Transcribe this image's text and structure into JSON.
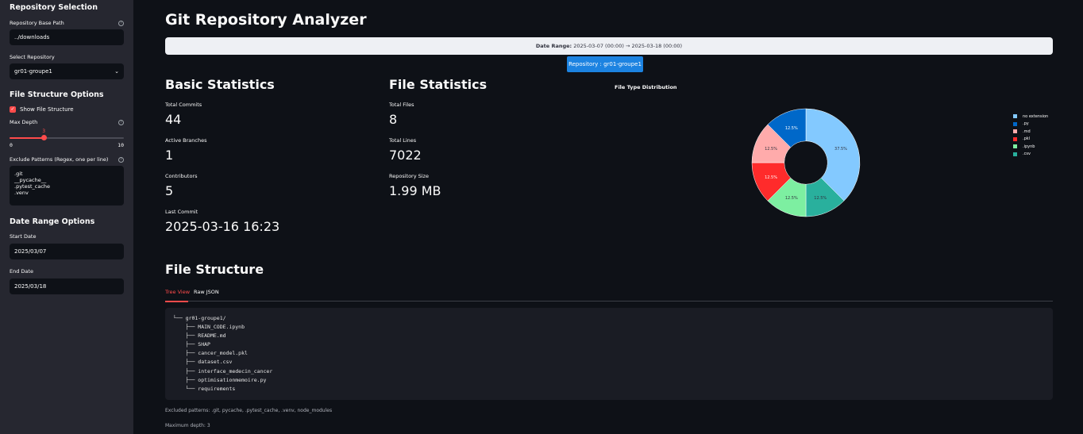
{
  "sidebar": {
    "repo_section": "Repository Selection",
    "base_path_label": "Repository Base Path",
    "base_path_value": "../downloads",
    "select_repo_label": "Select Repository",
    "select_repo_value": "gr01-groupe1",
    "file_struct_section": "File Structure Options",
    "show_file_structure": "Show File Structure",
    "max_depth_label": "Max Depth",
    "max_depth": {
      "value": 3,
      "min": 0,
      "max": 10,
      "value_label": "3",
      "min_label": "0",
      "max_label": "10"
    },
    "exclude_label": "Exclude Patterns (Regex, one per line)",
    "exclude_lines": [
      ".git",
      "__pycache__",
      ".pytest_cache",
      ".venv"
    ],
    "date_section": "Date Range Options",
    "start_label": "Start Date",
    "start_value": "2025/03/07",
    "end_label": "End Date",
    "end_value": "2025/03/18",
    "help_glyph": "?",
    "check_glyph": "✓",
    "chevron_glyph": "⌄"
  },
  "main": {
    "title": "Git Repository Analyzer",
    "date_range_label": "Date Range:",
    "date_range_value": "2025-03-07 (00:00) → 2025-03-18 (00:00)",
    "repo_button": "Repository : gr01-groupe1",
    "basic": {
      "heading": "Basic Statistics",
      "total_commits_label": "Total Commits",
      "total_commits": "44",
      "branches_label": "Active Branches",
      "branches": "1",
      "contributors_label": "Contributors",
      "contributors": "5",
      "last_commit_label": "Last Commit",
      "last_commit": "2025-03-16 16:23"
    },
    "file": {
      "heading": "File Statistics",
      "total_files_label": "Total Files",
      "total_files": "8",
      "total_lines_label": "Total Lines",
      "total_lines": "7022",
      "repo_size_label": "Repository Size",
      "repo_size": "1.99 MB"
    },
    "structure": {
      "heading": "File Structure",
      "tabs": [
        "Tree View",
        "Raw JSON"
      ],
      "tree": [
        "└── gr01-groupe1/",
        "    ├── MAIN_CODE.ipynb",
        "    ├── README.md",
        "    ├── SHAP",
        "    ├── cancer_model.pkl",
        "    ├── dataset.csv",
        "    ├── interface_medecin_cancer",
        "    ├── optimisationmemoire.py",
        "    └── requirements"
      ],
      "excluded_note": "Excluded patterns: .git, pycache, .pytest_cache, .venv, node_modules",
      "depth_note": "Maximum depth: 3"
    }
  },
  "chart_data": {
    "type": "pie",
    "title": "File Type Distribution",
    "labels": [
      "no extension",
      ".py",
      ".md",
      ".pkl",
      ".ipynb",
      ".csv"
    ],
    "slice_order": [
      "no extension",
      ".csv",
      ".ipynb",
      ".pkl",
      ".md",
      ".py"
    ],
    "values": [
      37.5,
      12.5,
      12.5,
      12.5,
      12.5,
      12.5
    ],
    "value_labels": [
      "37.5%",
      "12.5%",
      "12.5%",
      "12.5%",
      "12.5%",
      "12.5%"
    ],
    "colors": [
      "#83c9ff",
      "#0068c9",
      "#ffabab",
      "#ff2b2b",
      "#7defa1",
      "#29b09d"
    ],
    "hole": 0.4,
    "legend": "right"
  }
}
